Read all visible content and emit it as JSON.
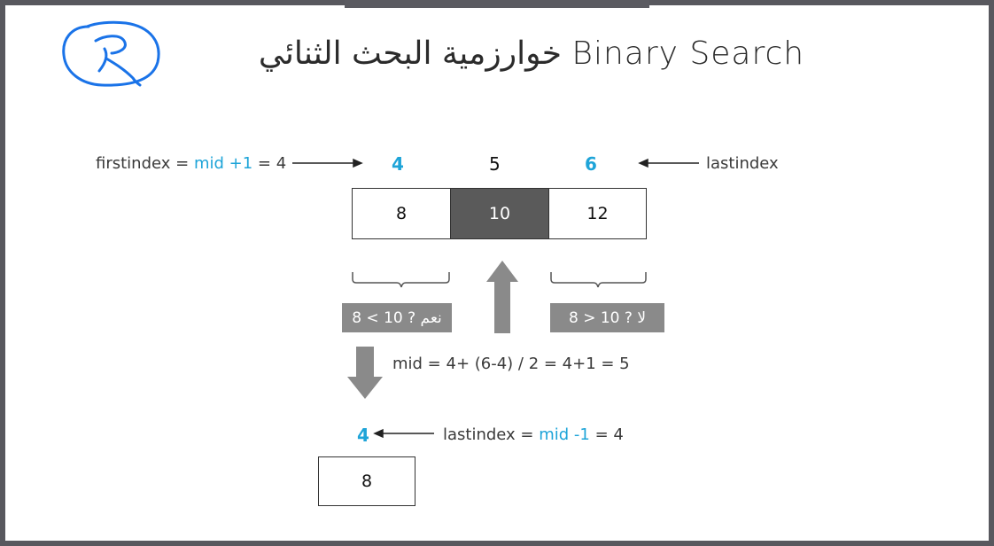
{
  "title": "خوارزمية البحث الثنائي Binary Search",
  "top_row": {
    "firstindex_prefix": "firstindex  = ",
    "firstindex_expr": "mid +1",
    "firstindex_suffix": " = 4",
    "lastindex_label": "lastindex",
    "index_left": "4",
    "index_mid": "5",
    "index_right": "6"
  },
  "array_cells": [
    {
      "value": "8",
      "highlighted": false
    },
    {
      "value": "10",
      "highlighted": true
    },
    {
      "value": "12",
      "highlighted": false
    }
  ],
  "comparisons": {
    "left": "8 < 10 ? نعم",
    "right": "8 > 10 ? لا"
  },
  "mid_formula": "mid = 4+ (6-4) / 2 = 4+1 = 5",
  "bottom_row": {
    "index": "4",
    "lastindex_prefix": "lastindex  = ",
    "lastindex_expr": "mid -1",
    "lastindex_suffix": " = 4"
  },
  "result_cell": "8",
  "colors": {
    "accent_blue": "#1ea4d8",
    "highlight_cell": "#5a5a5a",
    "label_gray": "#8a8a8a",
    "frame": "#58585e",
    "scribble": "#1a73e8"
  }
}
